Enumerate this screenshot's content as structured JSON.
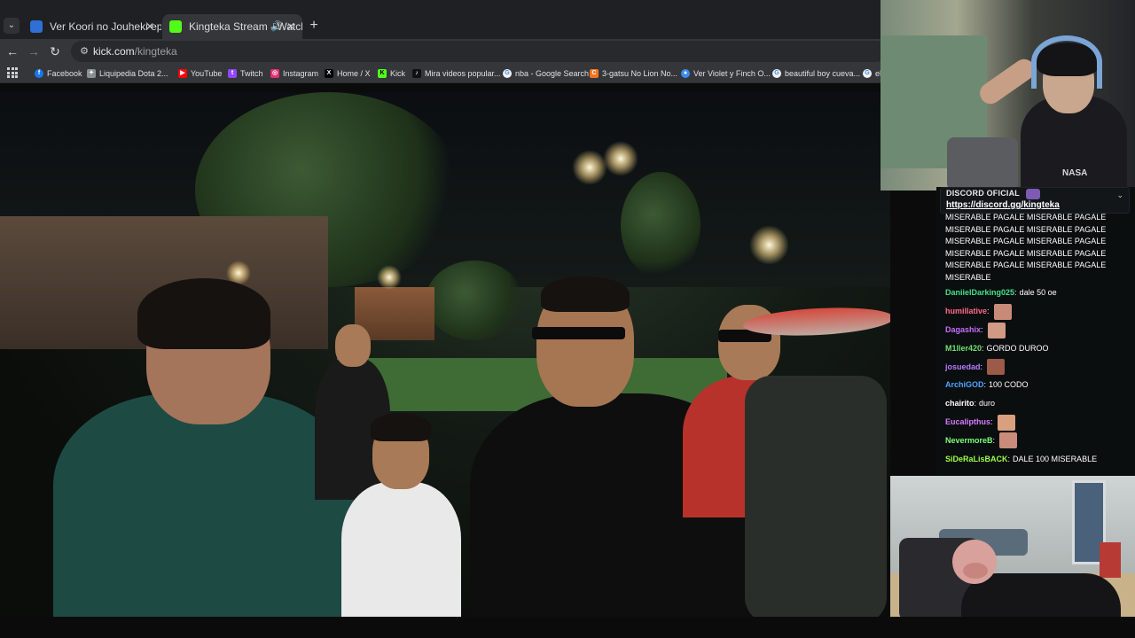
{
  "tabs": [
    {
      "title": "Ver Koori no Jouheki episodio",
      "active": false
    },
    {
      "title": "Kingteka Stream - Watch Live",
      "active": true
    }
  ],
  "toolbar": {
    "url_host": "kick.com",
    "url_path": "/kingteka"
  },
  "bookmarks": [
    {
      "label": "Facebook",
      "icon": "facebook-icon",
      "color": "#1877f2"
    },
    {
      "label": "Liquipedia Dota 2...",
      "icon": "liquipedia-icon",
      "color": "#8a8f94"
    },
    {
      "label": "YouTube",
      "icon": "youtube-icon",
      "color": "#ff0000"
    },
    {
      "label": "Twitch",
      "icon": "twitch-icon",
      "color": "#9146ff"
    },
    {
      "label": "Instagram",
      "icon": "instagram-icon",
      "color": "#e1306c"
    },
    {
      "label": "Home / X",
      "icon": "x-icon",
      "color": "#000000"
    },
    {
      "label": "Kick",
      "icon": "kick-icon",
      "color": "#53fc18"
    },
    {
      "label": "Mira videos popular...",
      "icon": "tiktok-icon",
      "color": "#111111"
    },
    {
      "label": "nba - Google Search",
      "icon": "google-icon",
      "color": "#4285f4"
    },
    {
      "label": "3-gatsu No Lion No...",
      "icon": "crunchyroll-icon",
      "color": "#f47521"
    },
    {
      "label": "Ver Violet y Finch O...",
      "icon": "chrome-icon",
      "color": "#3c8cf0"
    },
    {
      "label": "beautiful boy cueva...",
      "icon": "google-icon",
      "color": "#4285f4"
    },
    {
      "label": "el",
      "icon": "google-icon",
      "color": "#4285f4"
    }
  ],
  "chat": {
    "pinned_title": "DISCORD OFICIAL",
    "pinned_link": "https://discord.gg/kingteka",
    "spam_lines": [
      "MISERABLE PAGALE MISERABLE PAGALE",
      "MISERABLE PAGALE MISERABLE PAGALE",
      "MISERABLE PAGALE MISERABLE PAGALE",
      "MISERABLE PAGALE MISERABLE PAGALE",
      "MISERABLE PAGALE MISERABLE PAGALE",
      "MISERABLE"
    ],
    "messages": [
      {
        "user": "DaniielDarking025",
        "color": "#45e08a",
        "text": "dale 50 oe",
        "emote": false
      },
      {
        "user": "humillative",
        "color": "#ff6a8a",
        "text": "",
        "emote": true,
        "emote_color": "#c88b78"
      },
      {
        "user": "Dagashix",
        "color": "#c86bff",
        "text": "",
        "emote": true,
        "emote_color": "#d09a84"
      },
      {
        "user": "M1ller420",
        "color": "#6fe06f",
        "text": "GORDO DUROO",
        "emote": false
      },
      {
        "user": "josuedad",
        "color": "#b57bff",
        "text": "",
        "emote": true,
        "emote_color": "#9c5a4a"
      },
      {
        "user": "ArchiGOD",
        "color": "#4da3ff",
        "text": "100 CODO",
        "emote": false
      },
      {
        "user": "chairito",
        "color": "#ffffff",
        "text": "duro",
        "emote": false
      },
      {
        "user": "Eucalipthus",
        "color": "#d77bff",
        "text": "",
        "emote": true,
        "emote_color": "#d9a07f"
      },
      {
        "user": "NevermoreB",
        "color": "#7bff7b",
        "text": "",
        "emote": true,
        "emote_color": "#c98c7a"
      },
      {
        "user": "SiDeRaLisBACK",
        "color": "#9bff4a",
        "text": "DALE 100 MISERABLE",
        "emote": false
      }
    ]
  },
  "facecam": {
    "shirt_text": "NASA"
  }
}
